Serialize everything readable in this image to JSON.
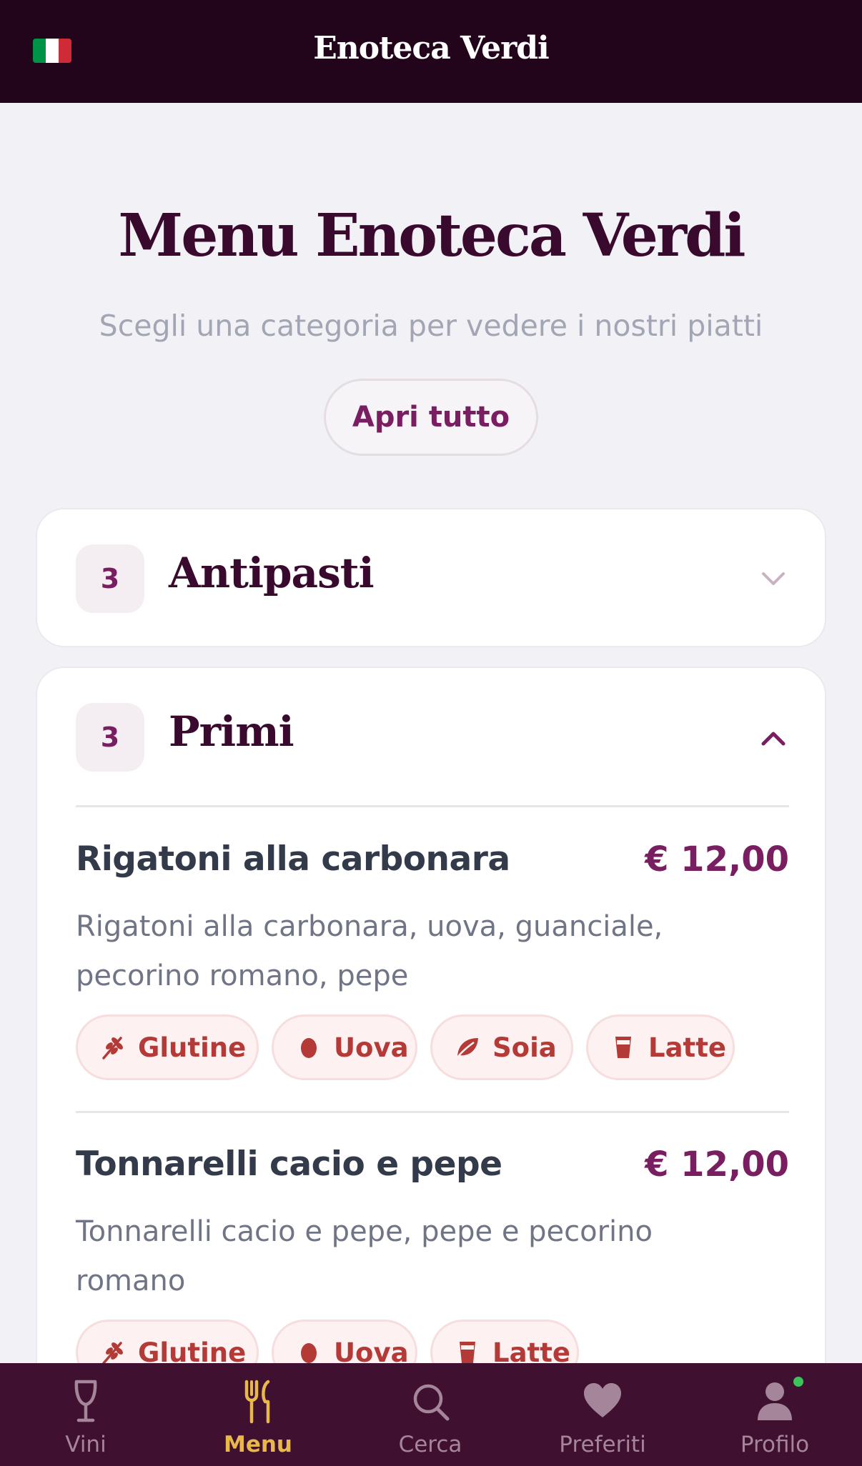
{
  "header": {
    "flag_icon": "italian-flag-icon",
    "flag_colors": [
      "#009246",
      "#ffffff",
      "#ce2b37"
    ],
    "title": "Enoteca Verdi"
  },
  "hero": {
    "title": "Menu Enoteca Verdi",
    "subtitle": "Scegli una categoria per vedere i nostri piatti",
    "open_all_label": "Apri tutto"
  },
  "categories": [
    {
      "count": "3",
      "name": "Antipasti",
      "expanded": false,
      "chevron_icon": "chevron-down-icon"
    },
    {
      "count": "3",
      "name": "Primi",
      "expanded": true,
      "chevron_icon": "chevron-up-icon",
      "items": [
        {
          "name": "Rigatoni alla carbonara",
          "price": "€ 12,00",
          "description": "Rigatoni alla carbonara, uova, guanciale, pecorino romano, pepe",
          "allergens": [
            {
              "label": "Glutine",
              "icon": "wheat-icon"
            },
            {
              "label": "Uova",
              "icon": "egg-icon"
            },
            {
              "label": "Soia",
              "icon": "leaf-icon"
            },
            {
              "label": "Latte",
              "icon": "milk-icon"
            }
          ]
        },
        {
          "name": "Tonnarelli cacio e pepe",
          "price": "€ 12,00",
          "description": "Tonnarelli cacio e pepe, pepe e pecorino romano",
          "allergens": [
            {
              "label": "Glutine",
              "icon": "wheat-icon"
            },
            {
              "label": "Uova",
              "icon": "egg-icon"
            },
            {
              "label": "Latte",
              "icon": "milk-icon"
            }
          ]
        }
      ]
    }
  ],
  "tabbar": {
    "active": "Menu",
    "items": [
      {
        "label": "Vini",
        "icon": "wine-glass-icon"
      },
      {
        "label": "Menu",
        "icon": "fork-knife-icon"
      },
      {
        "label": "Cerca",
        "icon": "search-icon"
      },
      {
        "label": "Preferiti",
        "icon": "heart-icon"
      },
      {
        "label": "Profilo",
        "icon": "user-icon"
      }
    ]
  },
  "colors": {
    "header_bg": "#22051a",
    "accent": "#7a1e62",
    "tabbar_bg": "#3f1030",
    "tab_active": "#e8b84a",
    "allergen_text": "#b33a36",
    "online_dot": "#3cc45a"
  }
}
